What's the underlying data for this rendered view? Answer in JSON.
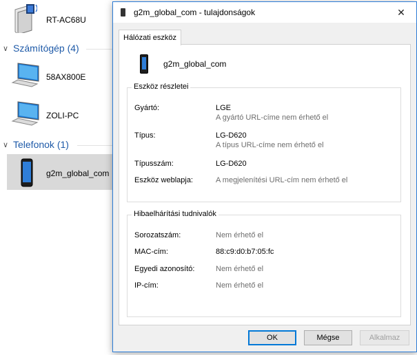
{
  "explorer": {
    "router": {
      "label": "RT-AC68U",
      "icon": "router-icon"
    },
    "groups": [
      {
        "title": "Számítógép (4)",
        "items": [
          {
            "label": "58AX800E",
            "icon": "monitor-icon"
          },
          {
            "label": "ZOLI-PC",
            "icon": "monitor-icon"
          }
        ]
      },
      {
        "title": "Telefonok (1)",
        "items": [
          {
            "label": "g2m_global_com",
            "icon": "phone-icon"
          }
        ]
      }
    ]
  },
  "dialog": {
    "title": "g2m_global_com - tulajdonságok",
    "tab": "Hálózati eszköz",
    "device_name": "g2m_global_com",
    "details": {
      "title": "Eszköz részletei",
      "rows": [
        {
          "label": "Gyártó:",
          "value": "LGE",
          "sub": "A gyártó URL-címe nem érhető el"
        },
        {
          "label": "Típus:",
          "value": "LG-D620",
          "sub": "A típus URL-címe nem érhető el"
        },
        {
          "label": "Típusszám:",
          "value": "LG-D620"
        },
        {
          "label": "Eszköz weblapja:",
          "value": "A megjelenítési URL-cím nem érhető el"
        }
      ]
    },
    "troubleshooting": {
      "title": "Hibaelhárítási tudnivalók",
      "rows": [
        {
          "label": "Sorozatszám:",
          "value": "Nem érhető el"
        },
        {
          "label": "MAC-cím:",
          "value": "88:c9:d0:b7:05:fc"
        },
        {
          "label": "Egyedi azonosító:",
          "value": "Nem érhető el"
        },
        {
          "label": "IP-cím:",
          "value": "Nem érhető el"
        }
      ]
    },
    "buttons": {
      "ok": "OK",
      "cancel": "Mégse",
      "apply": "Alkalmaz"
    }
  }
}
